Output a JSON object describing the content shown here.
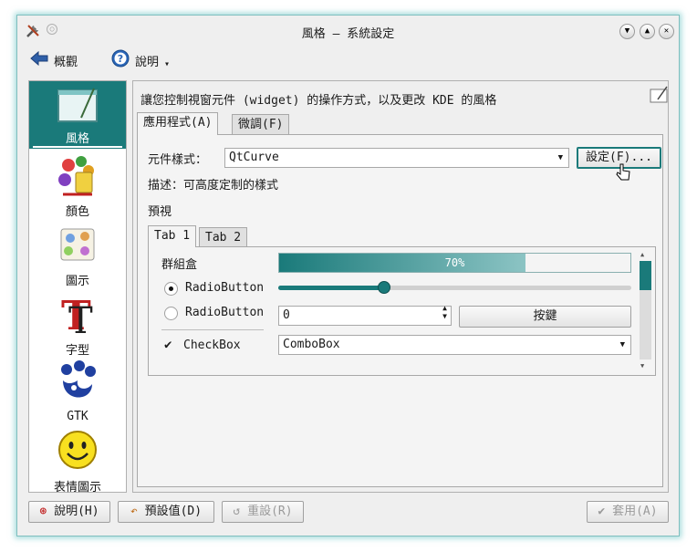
{
  "window": {
    "title": "風格 – 系統設定",
    "controls": {
      "help": "?",
      "minimize": "▲",
      "close": "✕"
    }
  },
  "toolbar": {
    "back_label": "概觀",
    "help_label": "說明",
    "help_dropdown": "▾"
  },
  "sidebar": {
    "items": [
      {
        "label": "風格",
        "icon": "style-icon",
        "selected": true
      },
      {
        "label": "顏色",
        "icon": "colors-icon"
      },
      {
        "label": "圖示",
        "icon": "icons-icon"
      },
      {
        "label": "字型",
        "icon": "fonts-icon"
      },
      {
        "label": "GTK",
        "icon": "gtk-icon"
      },
      {
        "label": "表情圖示",
        "icon": "emoticons-icon"
      }
    ]
  },
  "main": {
    "description": "讓您控制視窗元件 (widget) 的操作方式，以及更改 KDE 的風格",
    "tabs": [
      "應用程式(A)",
      "微調(F)"
    ],
    "widget_style_label": "元件樣式：",
    "widget_style_value": "QtCurve",
    "configure_button": "設定(F)...",
    "style_description": "描述：可高度定制的樣式",
    "preview_label": "預視",
    "preview": {
      "tabs": [
        "Tab 1",
        "Tab 2"
      ],
      "groupbox_label": "群組盒",
      "radio1": "RadioButton",
      "radio2": "RadioButton",
      "checkbox": "CheckBox",
      "progress_text": "70%",
      "progress_value": 0.7,
      "slider_value": 0.3,
      "spin_value": "0",
      "push_button": "按鍵",
      "combo_value": "ComboBox"
    }
  },
  "bottom": {
    "help_button": "說明(H)",
    "defaults_button": "預設值(D)",
    "reset_button": "重設(R)",
    "apply_button": "套用(A)"
  },
  "colors": {
    "accent": "#1a7a7a",
    "window_bg": "#efefef",
    "glow": "#5abebe"
  }
}
